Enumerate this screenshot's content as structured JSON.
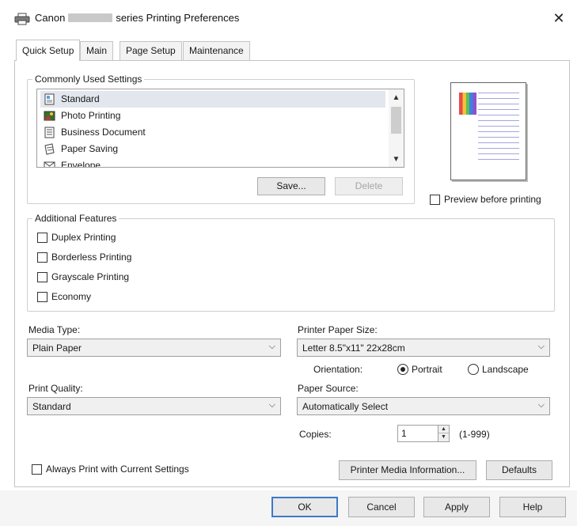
{
  "window": {
    "title_prefix": "Canon",
    "title_suffix": "series Printing Preferences",
    "close_glyph": "✕"
  },
  "tabs": [
    {
      "label": "Quick Setup",
      "active": true
    },
    {
      "label": "Main",
      "active": false
    },
    {
      "label": "Page Setup",
      "active": false
    },
    {
      "label": "Maintenance",
      "active": false
    }
  ],
  "commonly_used": {
    "label": "Commonly Used Settings",
    "items": [
      {
        "label": "Standard",
        "icon": "standard-icon",
        "selected": true
      },
      {
        "label": "Photo Printing",
        "icon": "photo-printing-icon",
        "selected": false
      },
      {
        "label": "Business Document",
        "icon": "business-document-icon",
        "selected": false
      },
      {
        "label": "Paper Saving",
        "icon": "paper-saving-icon",
        "selected": false
      },
      {
        "label": "Envelope",
        "icon": "envelope-icon",
        "selected": false
      }
    ],
    "save_label": "Save...",
    "delete_label": "Delete"
  },
  "preview": {
    "checkbox_label": "Preview before printing",
    "checked": false
  },
  "additional_features": {
    "label": "Additional Features",
    "options": [
      {
        "label": "Duplex Printing",
        "checked": false
      },
      {
        "label": "Borderless Printing",
        "checked": false
      },
      {
        "label": "Grayscale Printing",
        "checked": false
      },
      {
        "label": "Economy",
        "checked": false
      }
    ]
  },
  "media_type": {
    "label": "Media Type:",
    "value": "Plain Paper"
  },
  "printer_paper_size": {
    "label": "Printer Paper Size:",
    "value": "Letter 8.5\"x11\" 22x28cm"
  },
  "orientation": {
    "label": "Orientation:",
    "portrait_label": "Portrait",
    "landscape_label": "Landscape",
    "selected": "portrait"
  },
  "print_quality": {
    "label": "Print Quality:",
    "value": "Standard"
  },
  "paper_source": {
    "label": "Paper Source:",
    "value": "Automatically Select"
  },
  "copies": {
    "label": "Copies:",
    "value": "1",
    "range": "(1-999)"
  },
  "always_print": {
    "label": "Always Print with Current Settings",
    "checked": false
  },
  "printer_media_info_label": "Printer Media Information...",
  "defaults_label": "Defaults",
  "dialog_buttons": {
    "ok": "OK",
    "cancel": "Cancel",
    "apply": "Apply",
    "help": "Help"
  },
  "colors": {
    "accent": "#3f78c9",
    "selection": "#e2e6ed"
  }
}
